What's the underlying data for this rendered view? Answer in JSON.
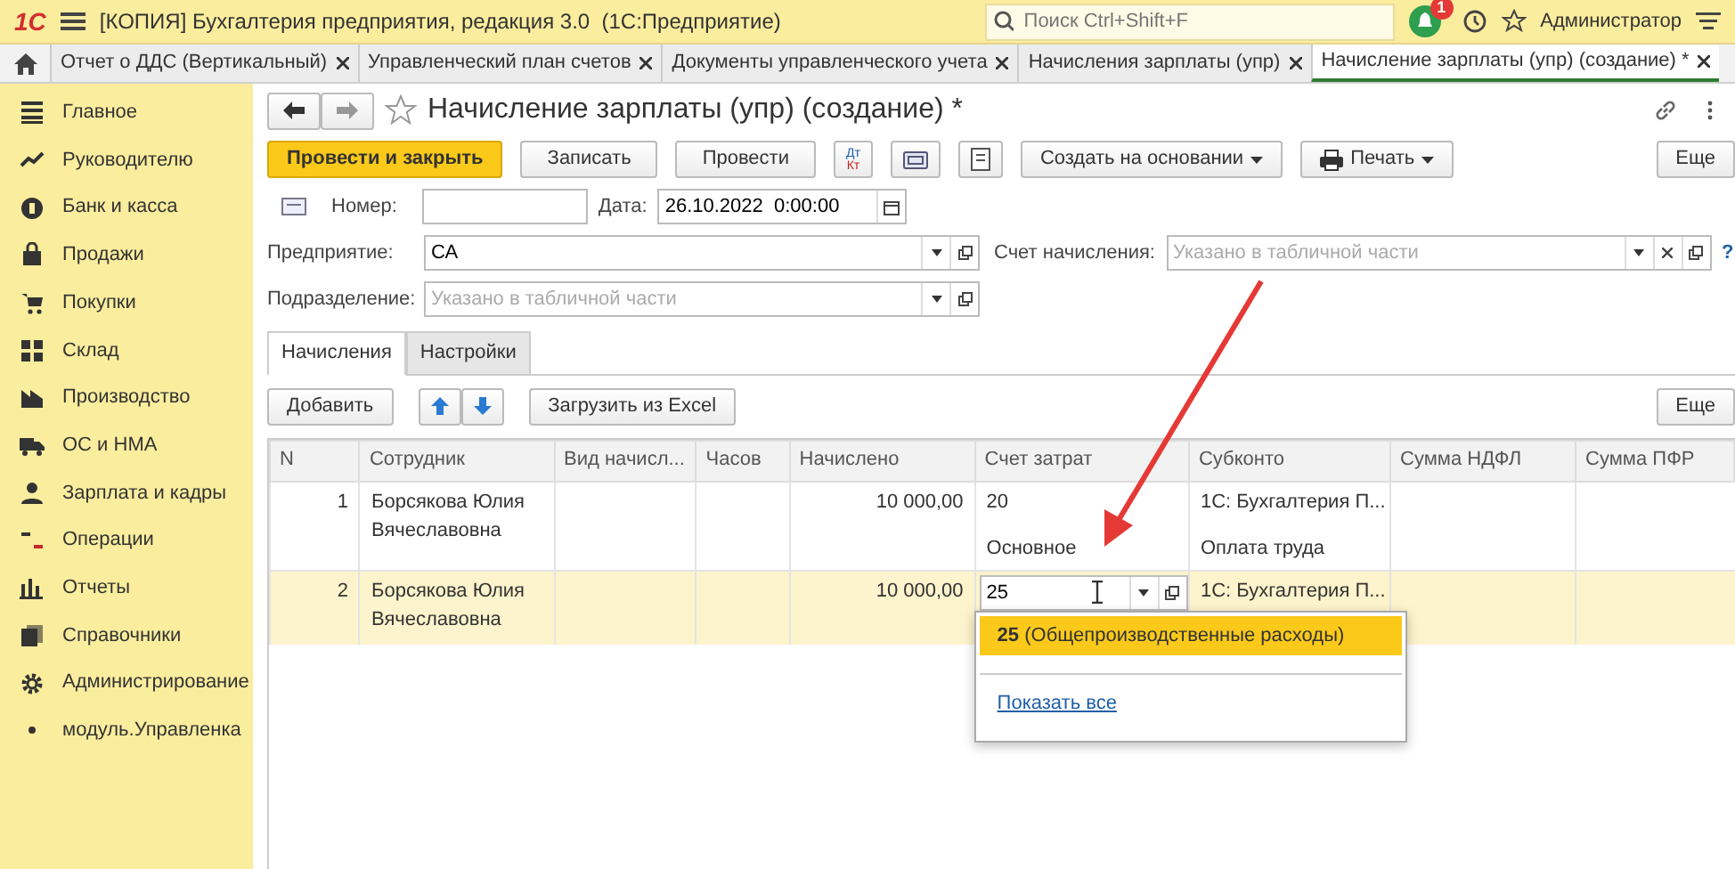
{
  "app": {
    "logo": "1С",
    "title": "[КОПИЯ] Бухгалтерия предприятия, редакция 3.0  (1С:Предприятие)",
    "search": {
      "placeholder": "Поиск Ctrl+Shift+F"
    },
    "notifications": "1",
    "user": "Администратор"
  },
  "tabs": [
    {
      "label": "Отчет о ДДС (Вертикальный)",
      "selected": false
    },
    {
      "label": "Управленческий план счетов",
      "selected": false
    },
    {
      "label": "Документы управленческого учета",
      "selected": false
    },
    {
      "label": "Начисления зарплаты (упр)",
      "selected": false
    },
    {
      "label": "Начисление зарплаты (упр) (создание) *",
      "selected": true
    }
  ],
  "sidebar": {
    "items": [
      {
        "label": "Главное",
        "kind": "lines"
      },
      {
        "label": "Руководителю",
        "kind": "trend"
      },
      {
        "label": "Банк и касса",
        "kind": "coin"
      },
      {
        "label": "Продажи",
        "kind": "bag"
      },
      {
        "label": "Покупки",
        "kind": "cart"
      },
      {
        "label": "Склад",
        "kind": "grid"
      },
      {
        "label": "Производство",
        "kind": "factory"
      },
      {
        "label": "ОС и НМА",
        "kind": "truck"
      },
      {
        "label": "Зарплата и кадры",
        "kind": "person"
      },
      {
        "label": "Операции",
        "kind": "ledger"
      },
      {
        "label": "Отчеты",
        "kind": "bars"
      },
      {
        "label": "Справочники",
        "kind": "books"
      },
      {
        "label": "Администрирование",
        "kind": "gear"
      },
      {
        "label": "модуль.Управленка",
        "kind": "dot"
      }
    ]
  },
  "document": {
    "title": "Начисление зарплаты (упр) (создание) *",
    "commands": [
      {
        "kind": "primary",
        "label": "Провести и закрыть"
      },
      {
        "kind": "plain",
        "label": "Записать"
      },
      {
        "kind": "plain",
        "label": "Провести"
      },
      {
        "kind": "dtkt",
        "top": "Дт",
        "bottom": "Кт"
      },
      {
        "kind": "ticket"
      },
      {
        "kind": "sheet"
      },
      {
        "kind": "menu",
        "label": "Создать на основании"
      },
      {
        "kind": "print",
        "label": "Печать"
      }
    ],
    "more": "Еще",
    "number": {
      "label": "Номер:"
    },
    "date": {
      "label": "Дата:",
      "value": "26.10.2022  0:00:00"
    },
    "enterprise": {
      "label": "Предприятие:",
      "value": "СА"
    },
    "account": {
      "label": "Счет начисления:",
      "placeholder": "Указано в табличной части",
      "help": "?"
    },
    "division": {
      "label": "Подразделение:",
      "placeholder": "Указано в табличной части"
    }
  },
  "form_tabs": [
    {
      "label": "Начисления",
      "selected": true
    },
    {
      "label": "Настройки",
      "selected": false
    }
  ],
  "table_toolbar": {
    "add": "Добавить",
    "upload": "Загрузить из Excel",
    "more": "Еще"
  },
  "table": {
    "columns": [
      "N",
      "Сотрудник",
      "Вид начисл...",
      "Часов",
      "Начислено",
      "Счет затрат",
      "Субконто",
      "Сумма НДФЛ",
      "Сумма ПФР"
    ],
    "rows": [
      {
        "n": "1",
        "employee": "Борсякова Юлия Вячеславовна",
        "accrued": "10 000,00",
        "account": "20",
        "account_sub": "Основное",
        "subconto": "1С: Бухгалтерия П...",
        "subconto_sub": "Оплата труда",
        "selected": false,
        "editing": false
      },
      {
        "n": "2",
        "employee": "Борсякова Юлия Вячеславовна",
        "accrued": "10 000,00",
        "account": "25",
        "subconto": "1С: Бухгалтерия П...",
        "selected": true,
        "editing": true
      }
    ]
  },
  "dropdown": {
    "items": [
      {
        "text": "**25** (Общепроизводственные расходы)",
        "selected": true
      }
    ],
    "show_all": "Показать все"
  }
}
